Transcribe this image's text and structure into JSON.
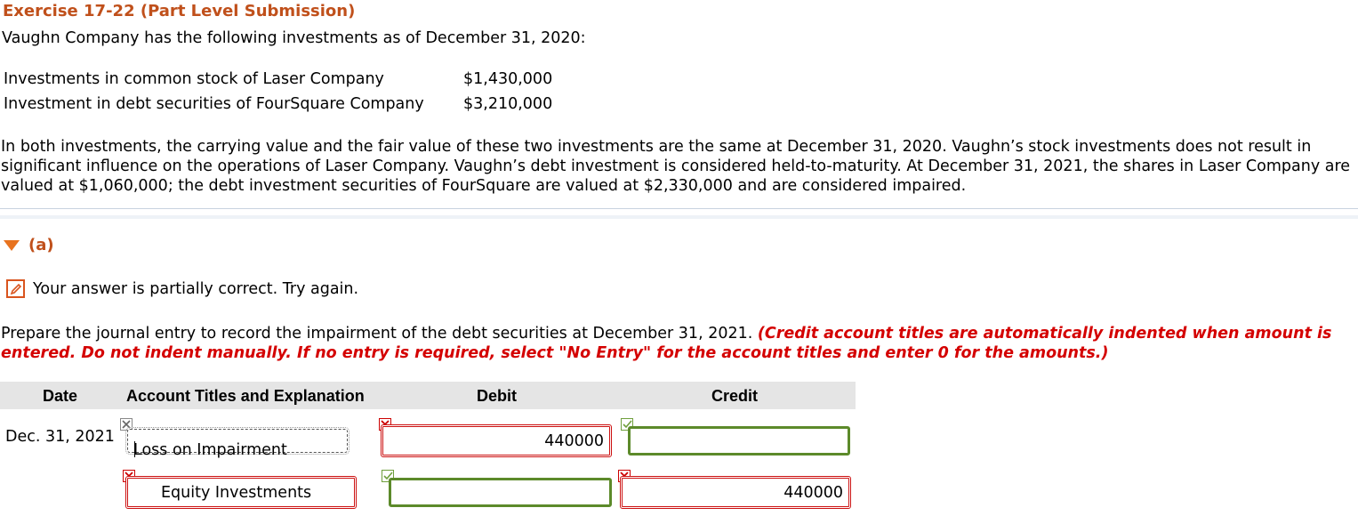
{
  "exercise_title": "Exercise 17-22 (Part Level Submission)",
  "intro": "Vaughn Company has the following investments as of December 31, 2020:",
  "investments": [
    {
      "name": "Investments in common stock of Laser Company",
      "amount": "$1,430,000"
    },
    {
      "name": "Investment in debt securities of FourSquare Company",
      "amount": "$3,210,000"
    }
  ],
  "paragraph": "In both investments, the carrying value and the fair value of these two investments are the same at December 31, 2020. Vaughn’s stock investments does not result in significant influence on the operations of Laser Company. Vaughn’s debt investment is considered held-to-maturity. At December 31, 2021, the shares in Laser Company are valued at $1,060,000; the debt investment securities of FourSquare are valued at $2,330,000 and are considered impaired.",
  "section": {
    "label": "(a)"
  },
  "status": {
    "text": "Your answer is partially correct.  Try again.",
    "color": "#d9541e"
  },
  "instruction": {
    "normal": "Prepare the journal entry to record the impairment of the debt securities at December 31, 2021. ",
    "red": "(Credit account titles are automatically indented when amount is entered. Do not indent manually. If no entry is required, select \"No Entry\" for the account titles and enter 0 for the amounts.)"
  },
  "table": {
    "headers": {
      "date": "Date",
      "account": "Account Titles and Explanation",
      "debit": "Debit",
      "credit": "Credit"
    },
    "rows": [
      {
        "date": "Dec. 31, 2021",
        "account": "Loss on Impairment",
        "debit": "440000",
        "credit": "",
        "account_mark": "none",
        "debit_mark": "incorrect",
        "credit_mark": "correct"
      },
      {
        "date": "",
        "account": "Equity Investments",
        "debit": "",
        "credit": "440000",
        "account_mark": "incorrect",
        "debit_mark": "correct",
        "credit_mark": "incorrect"
      }
    ]
  },
  "colors": {
    "title": "#c0501b",
    "incorrect": "#cc1111",
    "correct": "#5c8a2a",
    "header_bg": "#e5e5e5"
  }
}
